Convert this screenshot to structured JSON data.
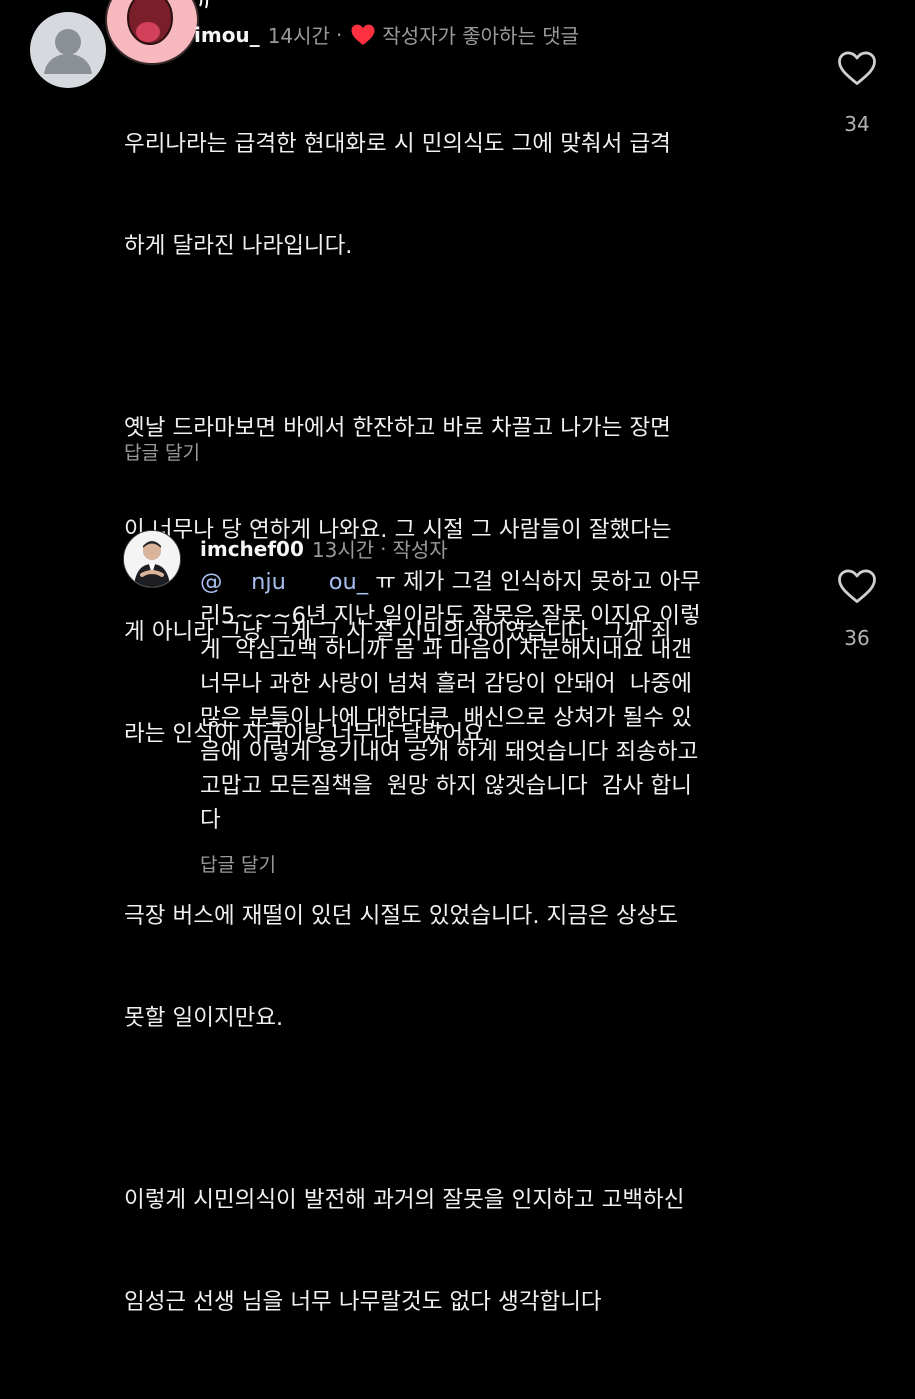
{
  "comments": [
    {
      "username": "imou_",
      "time": "14시간",
      "liked_label": "작성자가 좋아하는 댓글",
      "paragraphs": [
        [
          "우리나라는 급격한 현대화로 시 민의식도 그에 맞춰서 급격",
          "하게 달라진 나라입니다."
        ],
        [
          "옛날 드라마보면 바에서 한잔하고 바로 차끌고 나가는 장면",
          "이 너무나 당 연하게 나와요. 그 시절 그 사람들이 잘했다는",
          "게 아니라 그냥 그게 그 시 절 시민의식이였습니다. 그게 죄",
          "라는 인식이 지금이랑 너무나 달랐어요."
        ],
        [
          "극장 버스에 재떨이 있던 시절도 있었습니다. 지금은 상상도",
          "못할 일이지만요."
        ],
        [
          "이렇게 시민의식이 발전해 과거의 잘못을 인지하고 고백하신",
          "임성근 선생 님을 너무 나무랄것도 없다 생각합니다"
        ]
      ],
      "reply_label": "답글 달기",
      "likes": "34"
    },
    {
      "username": "imchef00",
      "time": "13시간",
      "author_label": "작성자",
      "mention": "@    nju      ou_",
      "first_line_rest": " ㅠ 제가 그걸 인식하지 못하고 아무",
      "lines": [
        "리5~~~6년 지난 일이라도 잘못은 잘못 이지요 이렇",
        "게  약심고백 하니까 몸 과 마음이 차분해지내요 내갠",
        "너무나 과한 사랑이 넘쳐 흘러 감당이 안돼어  나중에",
        "많은 분들이 나에 대한더큰  배신으로 상쳐가 될수 있",
        "음에 이렇게 용기내여 공개 하게 돼엇습니다 죄송하고",
        "고맙고 모든질책을  원망 하지 않겟습니다  감사 합니",
        "다"
      ],
      "reply_label": "답글 달기",
      "likes": "36"
    }
  ],
  "icons": {
    "heart_outline": "heart-outline-icon",
    "liked_heart": "heart-filled-icon",
    "liked_heart_color": "#ff3040"
  }
}
